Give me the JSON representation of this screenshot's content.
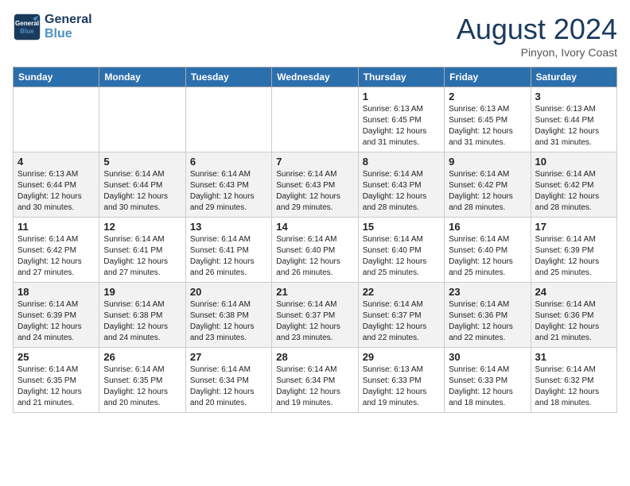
{
  "header": {
    "logo_line1": "General",
    "logo_line2": "Blue",
    "month_title": "August 2024",
    "location": "Pinyon, Ivory Coast"
  },
  "weekdays": [
    "Sunday",
    "Monday",
    "Tuesday",
    "Wednesday",
    "Thursday",
    "Friday",
    "Saturday"
  ],
  "weeks": [
    [
      {
        "day": "",
        "info": ""
      },
      {
        "day": "",
        "info": ""
      },
      {
        "day": "",
        "info": ""
      },
      {
        "day": "",
        "info": ""
      },
      {
        "day": "1",
        "info": "Sunrise: 6:13 AM\nSunset: 6:45 PM\nDaylight: 12 hours\nand 31 minutes."
      },
      {
        "day": "2",
        "info": "Sunrise: 6:13 AM\nSunset: 6:45 PM\nDaylight: 12 hours\nand 31 minutes."
      },
      {
        "day": "3",
        "info": "Sunrise: 6:13 AM\nSunset: 6:44 PM\nDaylight: 12 hours\nand 31 minutes."
      }
    ],
    [
      {
        "day": "4",
        "info": "Sunrise: 6:13 AM\nSunset: 6:44 PM\nDaylight: 12 hours\nand 30 minutes."
      },
      {
        "day": "5",
        "info": "Sunrise: 6:14 AM\nSunset: 6:44 PM\nDaylight: 12 hours\nand 30 minutes."
      },
      {
        "day": "6",
        "info": "Sunrise: 6:14 AM\nSunset: 6:43 PM\nDaylight: 12 hours\nand 29 minutes."
      },
      {
        "day": "7",
        "info": "Sunrise: 6:14 AM\nSunset: 6:43 PM\nDaylight: 12 hours\nand 29 minutes."
      },
      {
        "day": "8",
        "info": "Sunrise: 6:14 AM\nSunset: 6:43 PM\nDaylight: 12 hours\nand 28 minutes."
      },
      {
        "day": "9",
        "info": "Sunrise: 6:14 AM\nSunset: 6:42 PM\nDaylight: 12 hours\nand 28 minutes."
      },
      {
        "day": "10",
        "info": "Sunrise: 6:14 AM\nSunset: 6:42 PM\nDaylight: 12 hours\nand 28 minutes."
      }
    ],
    [
      {
        "day": "11",
        "info": "Sunrise: 6:14 AM\nSunset: 6:42 PM\nDaylight: 12 hours\nand 27 minutes."
      },
      {
        "day": "12",
        "info": "Sunrise: 6:14 AM\nSunset: 6:41 PM\nDaylight: 12 hours\nand 27 minutes."
      },
      {
        "day": "13",
        "info": "Sunrise: 6:14 AM\nSunset: 6:41 PM\nDaylight: 12 hours\nand 26 minutes."
      },
      {
        "day": "14",
        "info": "Sunrise: 6:14 AM\nSunset: 6:40 PM\nDaylight: 12 hours\nand 26 minutes."
      },
      {
        "day": "15",
        "info": "Sunrise: 6:14 AM\nSunset: 6:40 PM\nDaylight: 12 hours\nand 25 minutes."
      },
      {
        "day": "16",
        "info": "Sunrise: 6:14 AM\nSunset: 6:40 PM\nDaylight: 12 hours\nand 25 minutes."
      },
      {
        "day": "17",
        "info": "Sunrise: 6:14 AM\nSunset: 6:39 PM\nDaylight: 12 hours\nand 25 minutes."
      }
    ],
    [
      {
        "day": "18",
        "info": "Sunrise: 6:14 AM\nSunset: 6:39 PM\nDaylight: 12 hours\nand 24 minutes."
      },
      {
        "day": "19",
        "info": "Sunrise: 6:14 AM\nSunset: 6:38 PM\nDaylight: 12 hours\nand 24 minutes."
      },
      {
        "day": "20",
        "info": "Sunrise: 6:14 AM\nSunset: 6:38 PM\nDaylight: 12 hours\nand 23 minutes."
      },
      {
        "day": "21",
        "info": "Sunrise: 6:14 AM\nSunset: 6:37 PM\nDaylight: 12 hours\nand 23 minutes."
      },
      {
        "day": "22",
        "info": "Sunrise: 6:14 AM\nSunset: 6:37 PM\nDaylight: 12 hours\nand 22 minutes."
      },
      {
        "day": "23",
        "info": "Sunrise: 6:14 AM\nSunset: 6:36 PM\nDaylight: 12 hours\nand 22 minutes."
      },
      {
        "day": "24",
        "info": "Sunrise: 6:14 AM\nSunset: 6:36 PM\nDaylight: 12 hours\nand 21 minutes."
      }
    ],
    [
      {
        "day": "25",
        "info": "Sunrise: 6:14 AM\nSunset: 6:35 PM\nDaylight: 12 hours\nand 21 minutes."
      },
      {
        "day": "26",
        "info": "Sunrise: 6:14 AM\nSunset: 6:35 PM\nDaylight: 12 hours\nand 20 minutes."
      },
      {
        "day": "27",
        "info": "Sunrise: 6:14 AM\nSunset: 6:34 PM\nDaylight: 12 hours\nand 20 minutes."
      },
      {
        "day": "28",
        "info": "Sunrise: 6:14 AM\nSunset: 6:34 PM\nDaylight: 12 hours\nand 19 minutes."
      },
      {
        "day": "29",
        "info": "Sunrise: 6:13 AM\nSunset: 6:33 PM\nDaylight: 12 hours\nand 19 minutes."
      },
      {
        "day": "30",
        "info": "Sunrise: 6:14 AM\nSunset: 6:33 PM\nDaylight: 12 hours\nand 18 minutes."
      },
      {
        "day": "31",
        "info": "Sunrise: 6:14 AM\nSunset: 6:32 PM\nDaylight: 12 hours\nand 18 minutes."
      }
    ]
  ]
}
